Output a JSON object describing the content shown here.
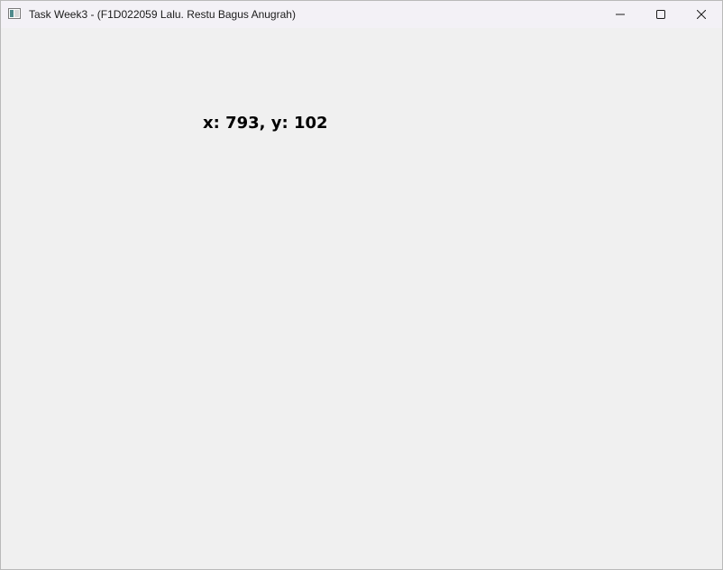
{
  "window": {
    "title": "Task Week3 - (F1D022059 Lalu. Restu Bagus Anugrah)",
    "icon": "app-window-icon",
    "controls": {
      "minimize_icon": "minimize-icon",
      "maximize_icon": "maximize-icon",
      "close_icon": "close-icon"
    }
  },
  "client": {
    "mouse_position_text": "x: 793, y: 102"
  },
  "colors": {
    "client_background": "#f0f0f0",
    "titlebar_background": "#f3f1f6",
    "text": "#000000"
  }
}
